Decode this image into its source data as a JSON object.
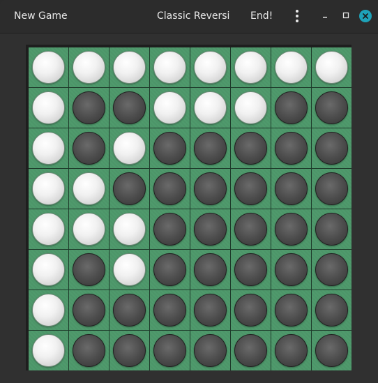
{
  "header": {
    "new_game_label": "New Game",
    "title": "Classic Reversi",
    "end_label": "End!"
  },
  "board": {
    "rows": [
      [
        "W",
        "W",
        "W",
        "W",
        "W",
        "W",
        "W",
        "W"
      ],
      [
        "W",
        "B",
        "B",
        "W",
        "W",
        "W",
        "B",
        "B"
      ],
      [
        "W",
        "B",
        "W",
        "B",
        "B",
        "B",
        "B",
        "B"
      ],
      [
        "W",
        "W",
        "B",
        "B",
        "B",
        "B",
        "B",
        "B"
      ],
      [
        "W",
        "W",
        "W",
        "B",
        "B",
        "B",
        "B",
        "B"
      ],
      [
        "W",
        "B",
        "W",
        "B",
        "B",
        "B",
        "B",
        "B"
      ],
      [
        "W",
        "B",
        "B",
        "B",
        "B",
        "B",
        "B",
        "B"
      ],
      [
        "W",
        "B",
        "B",
        "B",
        "B",
        "B",
        "B",
        "B"
      ]
    ]
  },
  "colors": {
    "board_green": "#4f9a6c",
    "close_accent": "#1ea2b8"
  }
}
